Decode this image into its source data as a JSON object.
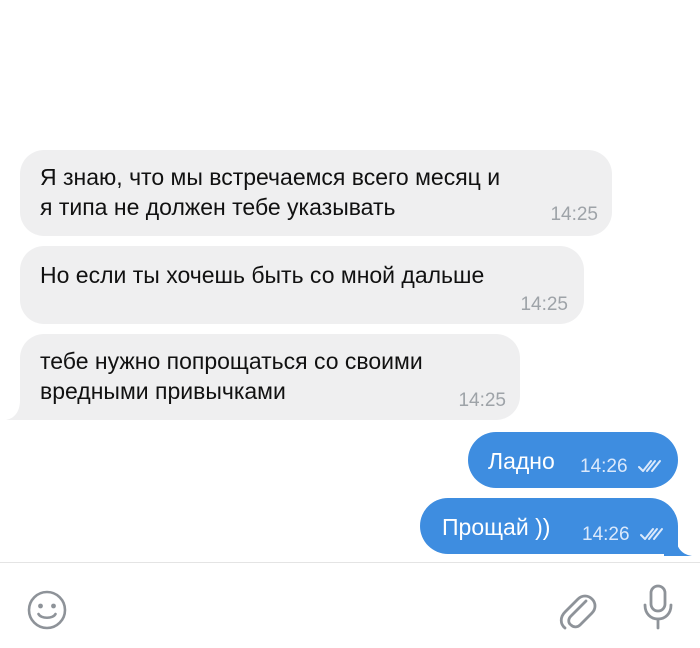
{
  "messages": [
    {
      "id": "m1",
      "direction": "incoming",
      "text": "Я знаю, что мы встречаемся всего месяц и\nя типа не должен тебе указывать",
      "time": "14:25"
    },
    {
      "id": "m2",
      "direction": "incoming",
      "text": "Но если ты хочешь быть со мной дальше",
      "time": "14:25"
    },
    {
      "id": "m3",
      "direction": "incoming",
      "text": "тебе нужно попрощаться со своими\nвредными привычками",
      "time": "14:25"
    },
    {
      "id": "m4",
      "direction": "outgoing",
      "text": "Ладно",
      "time": "14:26",
      "status": "read-double-check"
    },
    {
      "id": "m5",
      "direction": "outgoing",
      "text": "Прощай ))",
      "time": "14:26",
      "status": "read-double-check"
    }
  ],
  "composer": {
    "icons": [
      "emoji-icon",
      "attach-clip-icon",
      "microphone-icon"
    ]
  },
  "colors": {
    "incoming_bubble": "#efeff0",
    "outgoing_bubble": "#3e8de0",
    "icon_gray": "#8e9399"
  }
}
